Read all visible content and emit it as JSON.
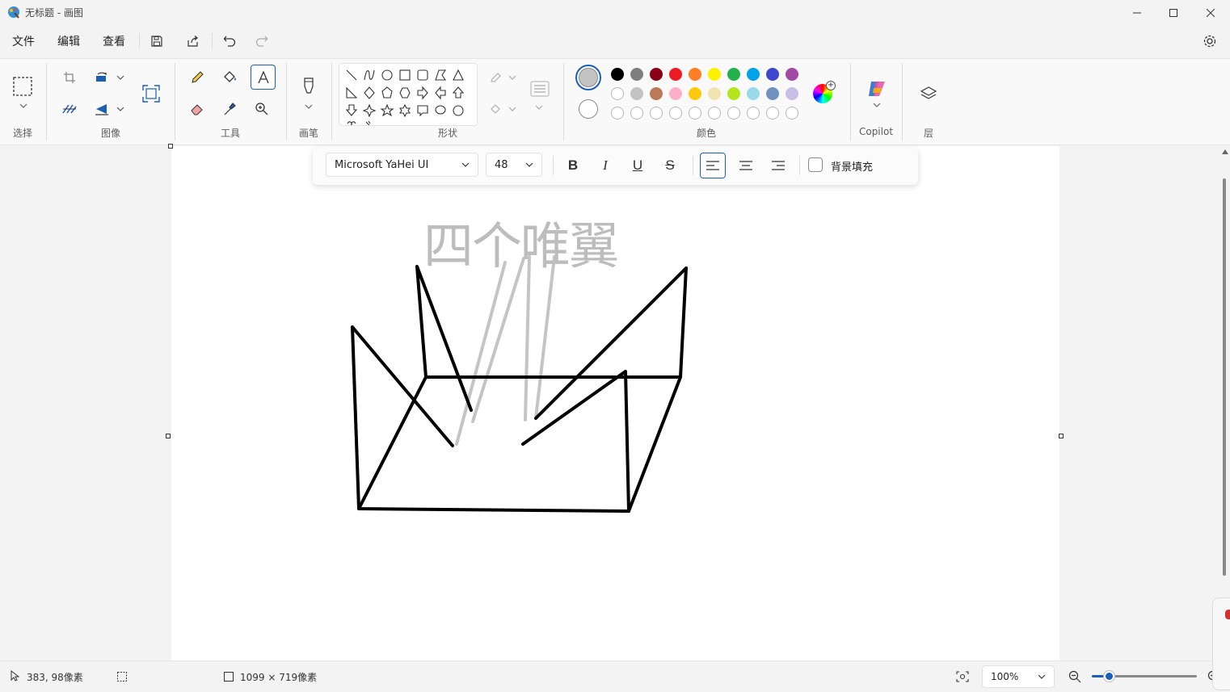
{
  "window": {
    "title": "无标题 - 画图"
  },
  "menu": {
    "file": "文件",
    "edit": "编辑",
    "view": "查看"
  },
  "ribbon": {
    "groups": {
      "select": "选择",
      "image": "图像",
      "tools": "工具",
      "brushes": "画笔",
      "shapes": "形状",
      "colors": "颜色",
      "copilot": "Copilot",
      "layers": "层"
    },
    "palette_row1": [
      "#000000",
      "#7f7f7f",
      "#880015",
      "#ed1c24",
      "#ff7f27",
      "#fff200",
      "#22b14c",
      "#00a2e8",
      "#3f48cc",
      "#a349a4"
    ],
    "palette_row2": [
      "#ffffff",
      "#c3c3c3",
      "#b97a57",
      "#ffaec9",
      "#ffc90e",
      "#efe4b0",
      "#b5e61d",
      "#99d9ea",
      "#7092be",
      "#c8bfe7"
    ],
    "color1": "#c3c3c3",
    "color2": "#ffffff",
    "copilot_label": "Copilot"
  },
  "text_toolbar": {
    "font_family": "Microsoft YaHei UI",
    "font_size": "48",
    "bold": "B",
    "italic": "I",
    "underline": "U",
    "strikethrough": "S",
    "background_fill": "背景填充"
  },
  "canvas": {
    "text": "四个唯翼"
  },
  "status": {
    "cursor_position": "383, 98像素",
    "canvas_size": "1099 × 719像素",
    "zoom": "100%"
  }
}
